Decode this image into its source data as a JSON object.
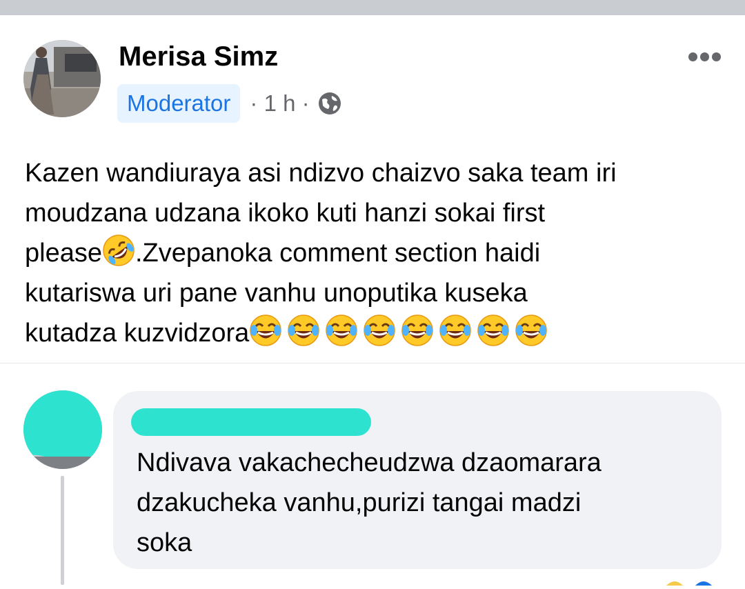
{
  "post": {
    "author_name": "Merisa Simz",
    "badge": "Moderator",
    "meta": "· 1 h ·",
    "privacy_icon": "globe-icon",
    "more_icon": "more-options-icon",
    "body_lines": [
      "Kazen wandiuraya asi ndizvo chaizvo saka team iri",
      "moudzana udzana ikoko kuti hanzi sokai first",
      "please",
      ".Zvepanoka comment section haidi",
      "kutariswa uri pane vanhu unoputika kuseka",
      "kutadza kuzvidzora"
    ],
    "emoji_rolling": "rolling-on-floor-laughing-emoji",
    "emoji_tears": "tears-of-joy-emoji"
  },
  "comment": {
    "author_redacted": true,
    "text_lines": [
      "Ndivava vakachecheudzwa dzaomarara",
      "dzakucheka vanhu,purizi tangai madzi",
      "soka"
    ]
  },
  "colors": {
    "badge_bg": "#e7f3ff",
    "badge_text": "#1b74e4",
    "bubble_bg": "#f0f2f5",
    "redaction": "#2de3d0",
    "meta_text": "#65676b"
  }
}
